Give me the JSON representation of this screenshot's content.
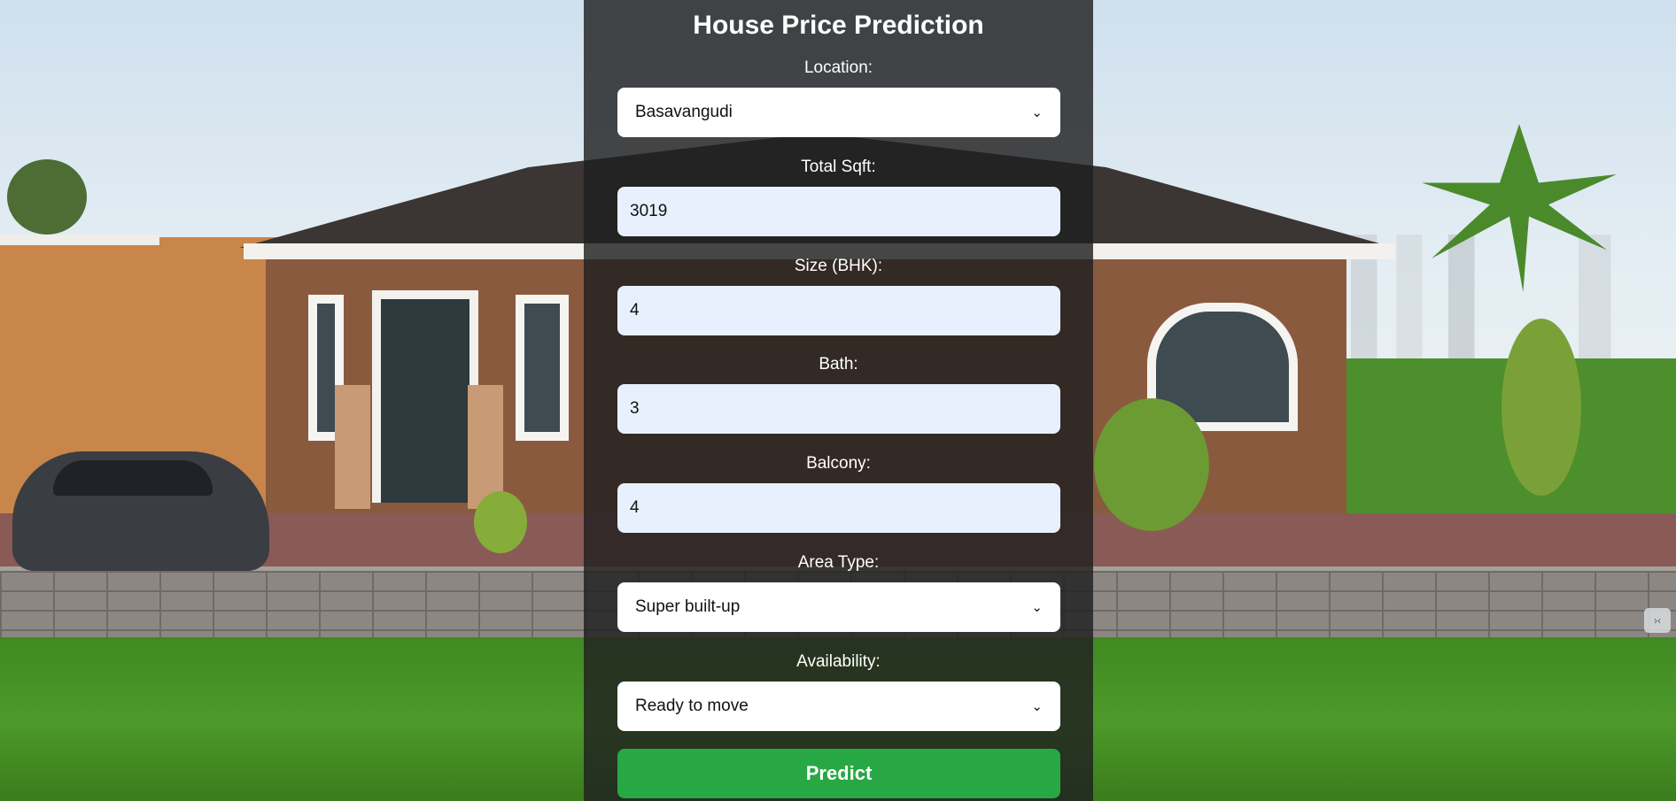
{
  "page": {
    "title": "House Price Prediction"
  },
  "form": {
    "location": {
      "label": "Location:",
      "value": "Basavangudi"
    },
    "total_sqft": {
      "label": "Total Sqft:",
      "value": "3019"
    },
    "size_bhk": {
      "label": "Size (BHK):",
      "value": "4"
    },
    "bath": {
      "label": "Bath:",
      "value": "3"
    },
    "balcony": {
      "label": "Balcony:",
      "value": "4"
    },
    "area_type": {
      "label": "Area Type:",
      "value": "Super built-up"
    },
    "availability": {
      "label": "Availability:",
      "value": "Ready to move"
    },
    "predict_label": "Predict"
  },
  "icons": {
    "select_chevron": "chevron-down-icon",
    "extension_badge": "extension-icon"
  },
  "colors": {
    "panel_overlay": "#202020",
    "input_fill": "#e8f0fe",
    "select_fill": "#ffffff",
    "predict_button": "#28a745",
    "text_on_panel": "#ffffff"
  }
}
